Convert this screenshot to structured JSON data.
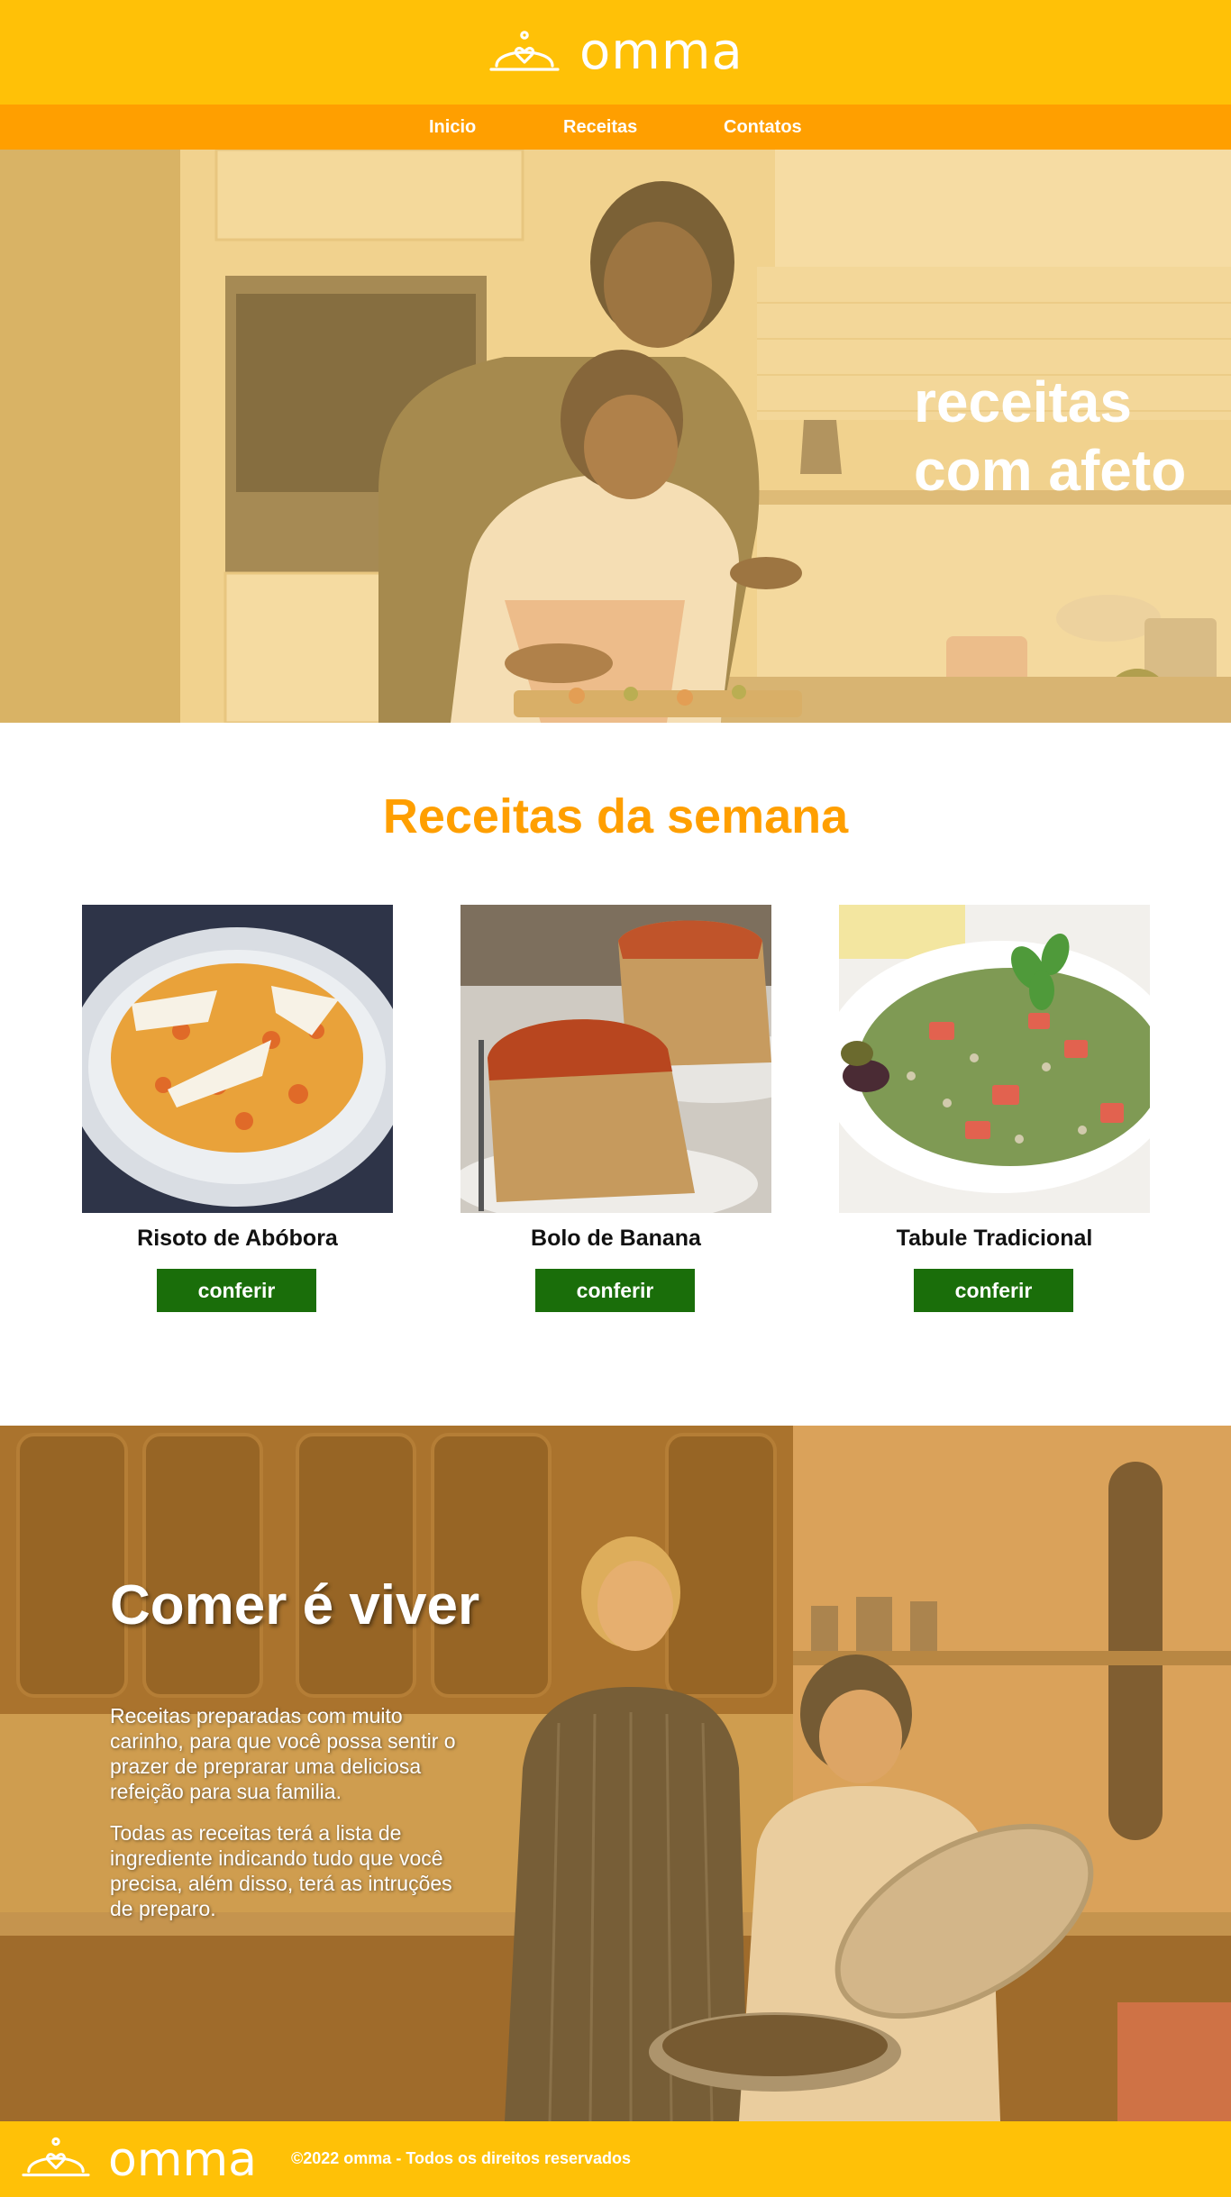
{
  "brand": {
    "name": "omma",
    "primary_color": "#ffc107",
    "accent_color": "#ff9f00",
    "button_color": "#1a6e0a"
  },
  "nav": {
    "items": [
      "Inicio",
      "Receitas",
      "Contatos"
    ]
  },
  "hero": {
    "title": "receitas\ncom afeto",
    "image": "mother-daughter-cooking-photo"
  },
  "recipes": {
    "title": "Receitas da semana",
    "items": [
      {
        "name": "Risoto de Abóbora",
        "button": "conferir",
        "image": "risotto-photo"
      },
      {
        "name": "Bolo de Banana",
        "button": "conferir",
        "image": "banana-cake-photo"
      },
      {
        "name": "Tabule Tradicional",
        "button": "conferir",
        "image": "tabbouleh-photo"
      }
    ]
  },
  "about": {
    "title": "Comer é viver",
    "paragraphs": [
      "Receitas preparadas com muito carinho, para que você possa sentir o prazer de preprarar uma deliciosa refeição para sua familia.",
      "Todas as receitas terá a lista de ingrediente indicando tudo que você precisa, além disso, terá as intruções de preparo."
    ],
    "image": "two-women-cooking-photo"
  },
  "footer": {
    "brand": "omma",
    "copyright": "©2022 omma - Todos os direitos reservados"
  }
}
